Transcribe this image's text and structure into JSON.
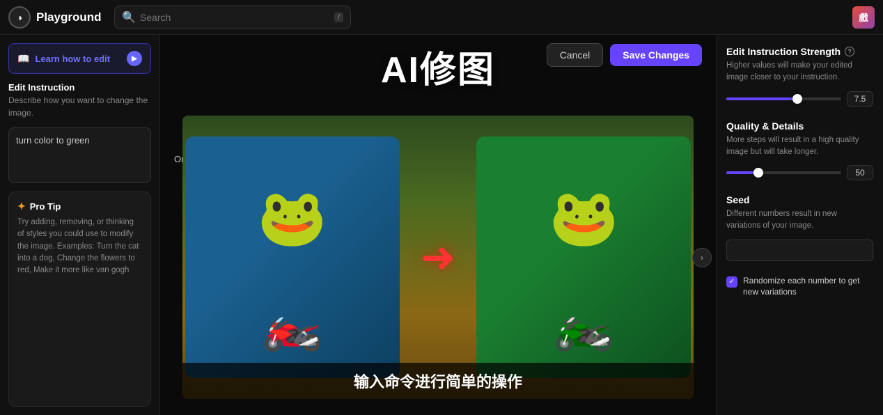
{
  "topnav": {
    "brand_icon": "◑",
    "brand_name": "Playground",
    "search_placeholder": "Search",
    "search_shortcut": "/",
    "user_initial": "戲"
  },
  "sidebar": {
    "learn_btn_label": "Learn how to edit",
    "play_icon": "▶",
    "edit_instruction": {
      "title": "Edit Instruction",
      "desc": "Describe how you want to change the image.",
      "value": "turn color to green"
    },
    "pro_tip": {
      "title": "Pro Tip",
      "icon": "✦",
      "text": "Try adding, removing, or thinking of styles you could use to modify the image. Examples: Turn the cat into a dog, Change the flowers to red, Make it more like van gogh"
    }
  },
  "canvas": {
    "title": "AI修图",
    "cancel_label": "Cancel",
    "save_label": "Save Changes",
    "original_label": "Original",
    "subtitle": "输入命令进行简单的操作",
    "chevron": "›"
  },
  "right_panel": {
    "strength": {
      "title": "Edit Instruction Strength",
      "desc": "Higher values will make your edited image closer to your instruction.",
      "value": "7.5",
      "fill_pct": 62
    },
    "quality": {
      "title": "Quality & Details",
      "desc": "More steps will result in a high quality image but will take longer.",
      "value": "50",
      "fill_pct": 28
    },
    "seed": {
      "title": "Seed",
      "desc": "Different numbers result in new variations of your image.",
      "placeholder": ""
    },
    "randomize": {
      "label": "Randomize each number to get new variations",
      "checked": true
    }
  }
}
